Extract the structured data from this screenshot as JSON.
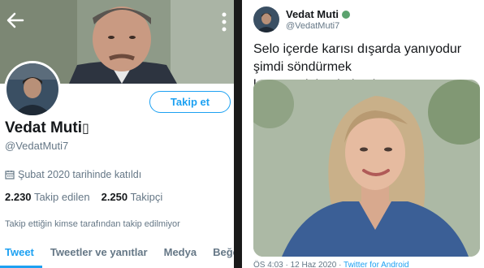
{
  "profile": {
    "name": "Vedat Muti",
    "name_glyph": "▯",
    "handle": "@VedatMuti7",
    "follow_label": "Takip et",
    "joined": "Şubat 2020 tarihinde katıldı",
    "following_count": "2.230",
    "following_label": "Takip edilen",
    "followers_count": "2.250",
    "followers_label": "Takipçi",
    "followed_by_note": "Takip ettiğin kimse tarafından takip edilmiyor",
    "tabs": [
      "Tweet",
      "Tweetler ve yanıtlar",
      "Medya",
      "Beğe"
    ]
  },
  "tweet": {
    "author": "Vedat Muti",
    "handle": "@VedatMuti7",
    "text": "Selo içerde karısı dışarda yanıyodur şimdi söndürmek lazım#selahattindemirtaş",
    "meta_time": "ÖS 4:03 · 12 Haz 2020 ·",
    "meta_source": "Twitter for Android"
  },
  "icons": {
    "back": "arrow-left-icon",
    "more": "more-vertical-icon",
    "calendar": "calendar-icon",
    "status": "status-dot-icon"
  },
  "colors": {
    "accent": "#1da1f2",
    "text": "#14171a",
    "muted": "#657786",
    "status_dot": "#5ca36f"
  }
}
